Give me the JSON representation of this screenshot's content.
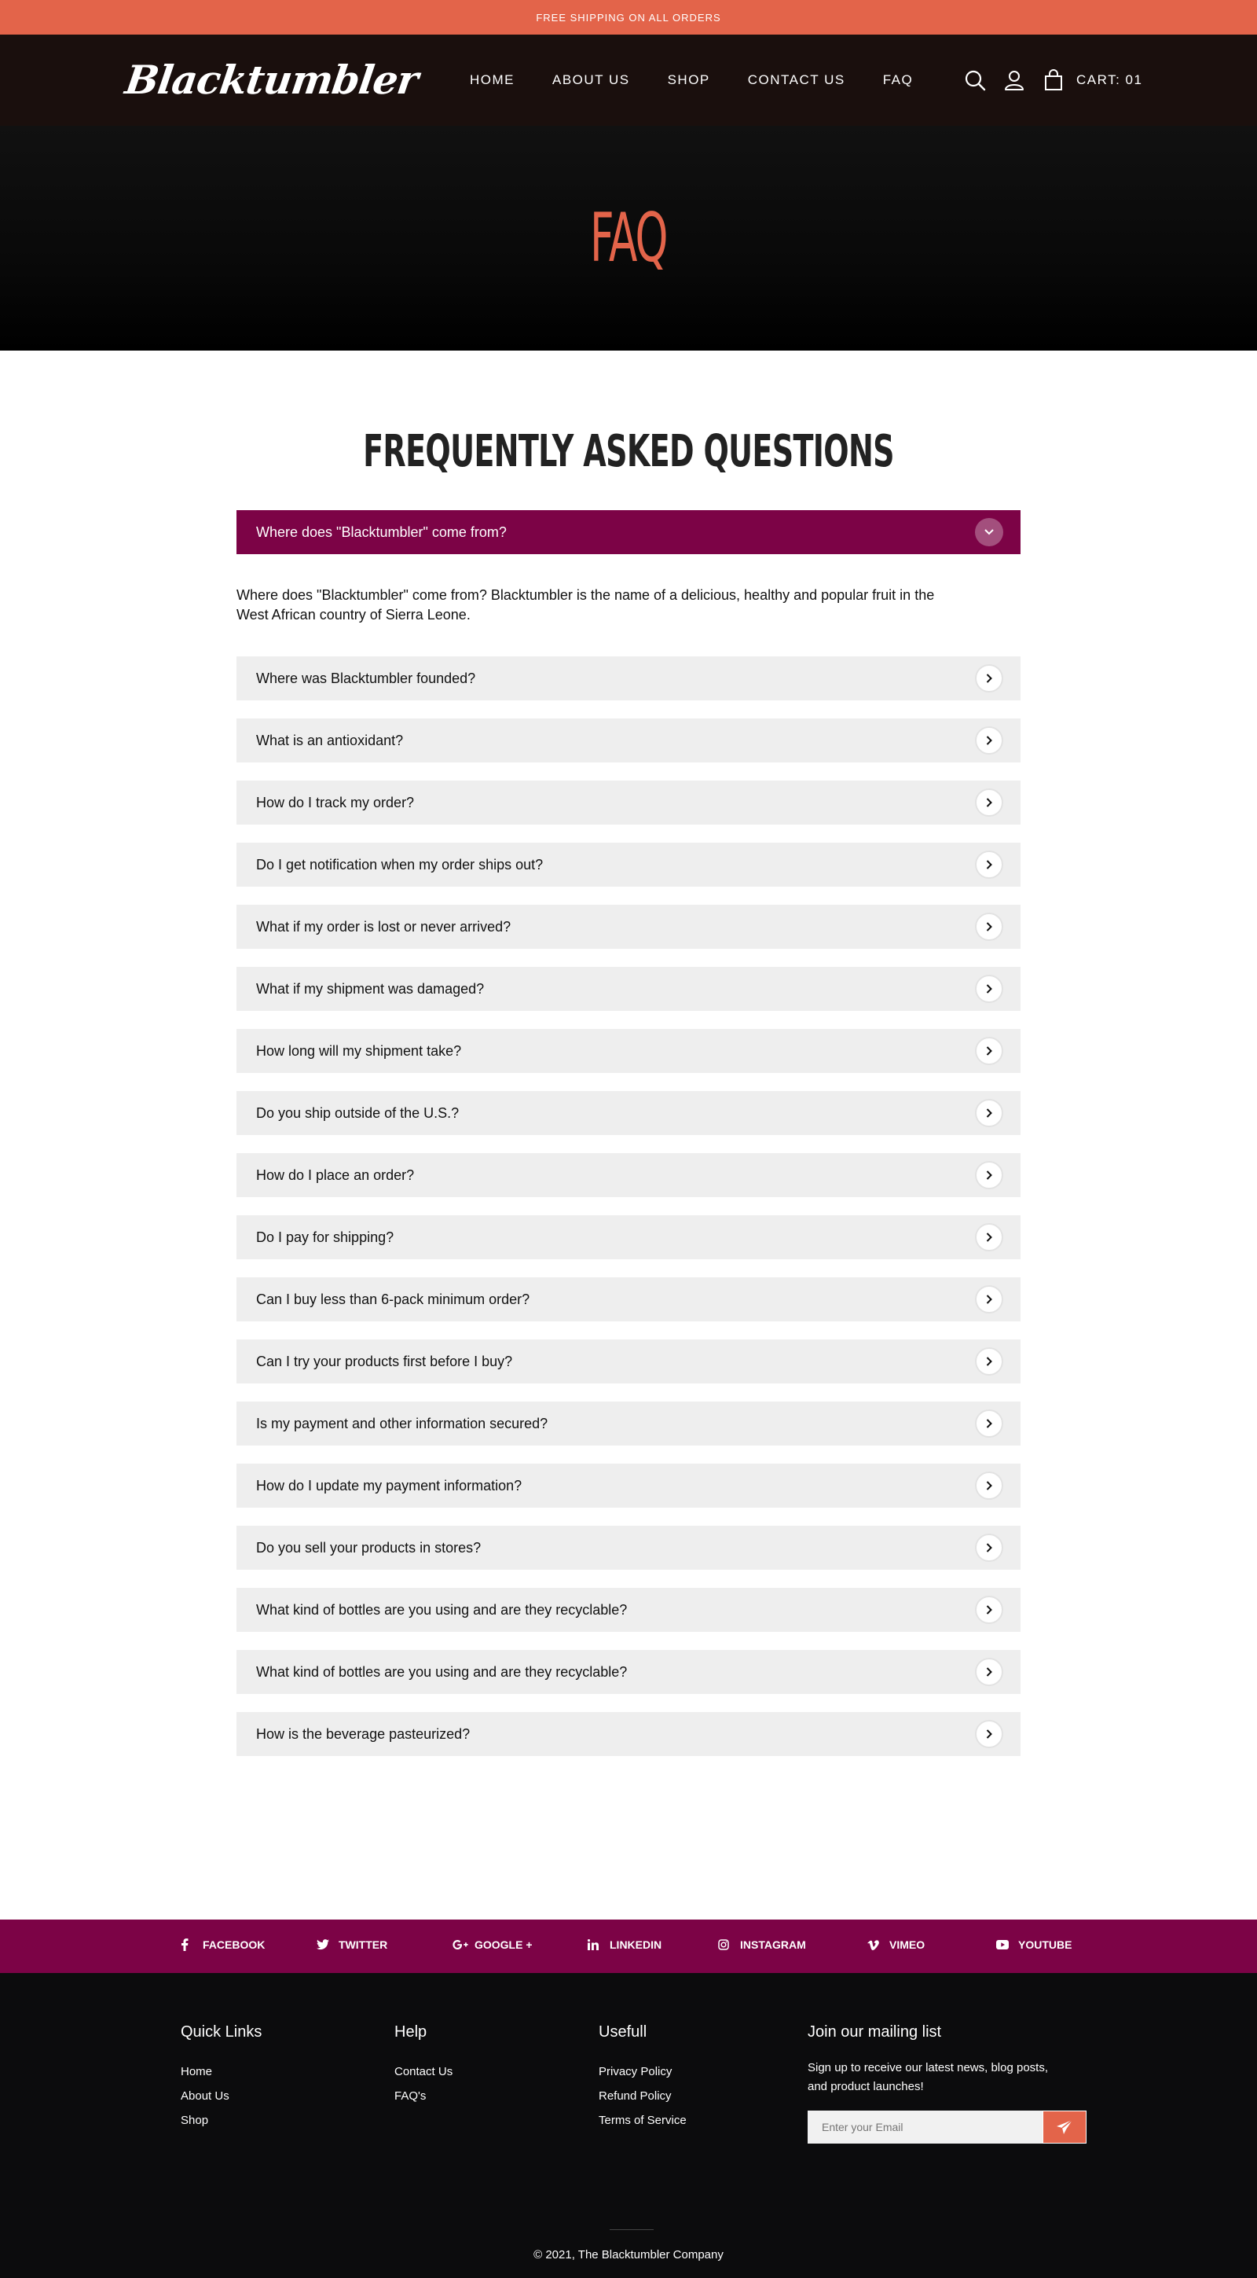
{
  "topbar": {
    "text": "FREE SHIPPING ON ALL ORDERS"
  },
  "header": {
    "logo": "Blacktumbler",
    "nav": [
      "HOME",
      "ABOUT US",
      "SHOP",
      "CONTACT US",
      "FAQ"
    ],
    "icons": [
      "search-icon",
      "user-icon",
      "bag-icon"
    ],
    "cart_label": "CART: 01"
  },
  "hero": {
    "title": "FAQ"
  },
  "faq": {
    "heading": "FREQUENTLY ASKED QUESTIONS",
    "open_question": "Where does \"Blacktumbler\" come from?",
    "open_answer": "Where does \"Blacktumbler\" come from? Blacktumbler is the name of a delicious, healthy and popular fruit in the West African country of Sierra Leone.",
    "questions": [
      "Where was Blacktumbler founded?",
      "What is an antioxidant?",
      "How do I track my order?",
      "Do I get notification when my order ships out?",
      "What if my order is lost or never arrived?",
      "What if my shipment was damaged?",
      "How long will my shipment take?",
      "Do you ship outside of the U.S.?",
      "How do I place an order?",
      "Do I pay for shipping?",
      "Can I buy less than 6-pack minimum order?",
      "Can I try your products first before I buy?",
      "Is my payment and other information secured?",
      "How do I update my payment information?",
      "Do you sell your products in stores?",
      "What kind of bottles are you using and are they recyclable?",
      "What kind of bottles are you using and are they recyclable?",
      "How is the beverage pasteurized?"
    ]
  },
  "social": {
    "facebook": "FACEBOOK",
    "twitter": "TWITTER",
    "google": "GOOGLE +",
    "linkedin": "LINKEDIN",
    "instagram": "INSTAGRAM",
    "vimeo": "VIMEO",
    "youtube": "YOUTUBE"
  },
  "footer": {
    "quick_links": {
      "title": "Quick Links",
      "items": [
        "Home",
        "About Us",
        "Shop"
      ]
    },
    "help": {
      "title": "Help",
      "items": [
        "Contact Us",
        "FAQ's"
      ]
    },
    "usefull": {
      "title": "Usefull",
      "items": [
        "Privacy Policy",
        "Refund Policy",
        "Terms of Service"
      ]
    },
    "mailing": {
      "title": "Join our mailing list",
      "text": "Sign up to receive our latest news, blog posts, and product launches!",
      "placeholder": "Enter your Email"
    },
    "copyright": "© 2021, The Blacktumbler Company"
  },
  "colors": {
    "accent": "#e3644a",
    "brand": "#7c0346",
    "header_bg": "#1a0f0d",
    "footer_bg": "#0c0c0d"
  }
}
